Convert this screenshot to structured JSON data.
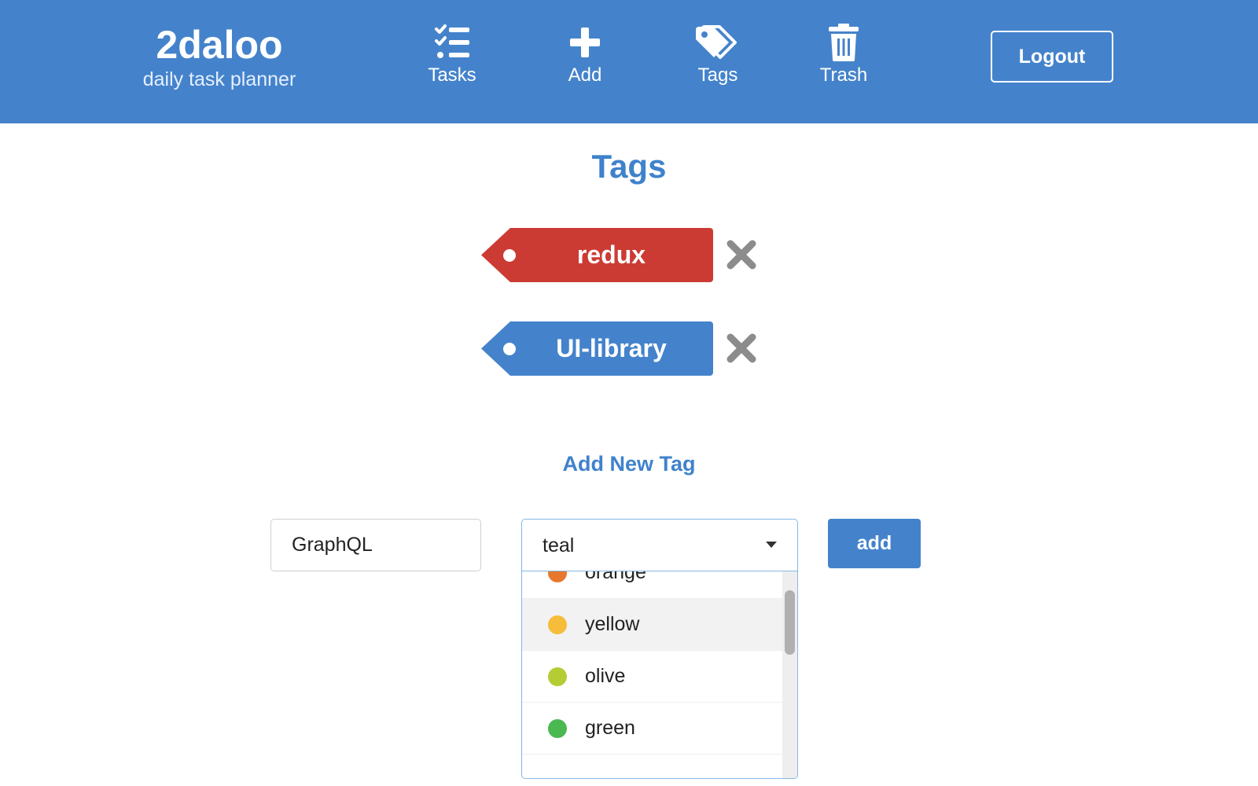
{
  "header": {
    "brand_title": "2daloo",
    "brand_subtitle": "daily task planner",
    "nav": [
      {
        "label": "Tasks",
        "icon": "tasks-list-icon"
      },
      {
        "label": "Add",
        "icon": "plus-icon"
      },
      {
        "label": "Tags",
        "icon": "tags-icon"
      },
      {
        "label": "Trash",
        "icon": "trash-icon"
      }
    ],
    "logout_label": "Logout",
    "background": "#4483cb"
  },
  "page_title": "Tags",
  "tags": [
    {
      "label": "redux",
      "color": "#cc3b33",
      "remove_icon": "close-icon"
    },
    {
      "label": "UI-library",
      "color": "#4483cb",
      "remove_icon": "close-icon"
    }
  ],
  "add_form": {
    "title": "Add New Tag",
    "name_value": "GraphQL",
    "color_selected": "teal",
    "color_options": [
      {
        "label": "orange",
        "color": "#e8772e"
      },
      {
        "label": "yellow",
        "color": "#f5bd3a",
        "highlighted": true
      },
      {
        "label": "olive",
        "color": "#b5cc35"
      },
      {
        "label": "green",
        "color": "#4bb852"
      }
    ],
    "add_label": "add"
  }
}
